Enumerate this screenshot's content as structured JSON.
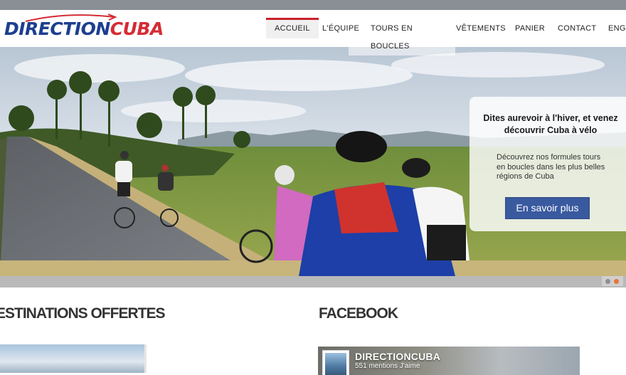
{
  "brand": {
    "part1": "DIRECTION",
    "part2": "CUBA"
  },
  "nav": {
    "items": [
      {
        "label": "Accueil",
        "active": true
      },
      {
        "label": "L'équipe"
      },
      {
        "label": "Tours en"
      },
      {
        "label": "boucles"
      },
      {
        "label": "Vêtements"
      },
      {
        "label": "Panier"
      },
      {
        "label": "Contact"
      },
      {
        "label": "Engl"
      }
    ]
  },
  "hero": {
    "promo_title": "Dites aurevoir à l'hiver, et venez découvrir Cuba à vélo",
    "promo_body": "Découvrez nos formules tours en boucles dans les plus belles régions de Cuba",
    "cta_label": "En savoir plus",
    "slider": {
      "slides": 2,
      "active_index": 1
    }
  },
  "sections": {
    "destinations_title": "ESTINATIONS OFFERTES",
    "facebook_title": "FACEBOOK"
  },
  "facebook": {
    "page_name": "DIRECTIONCUBA",
    "likes_text": "551 mentions J'aime"
  },
  "colors": {
    "brand_blue": "#1c3f8f",
    "brand_red": "#d52b34",
    "cta_blue": "#3a5aa0",
    "slider_active": "#e8743b"
  }
}
